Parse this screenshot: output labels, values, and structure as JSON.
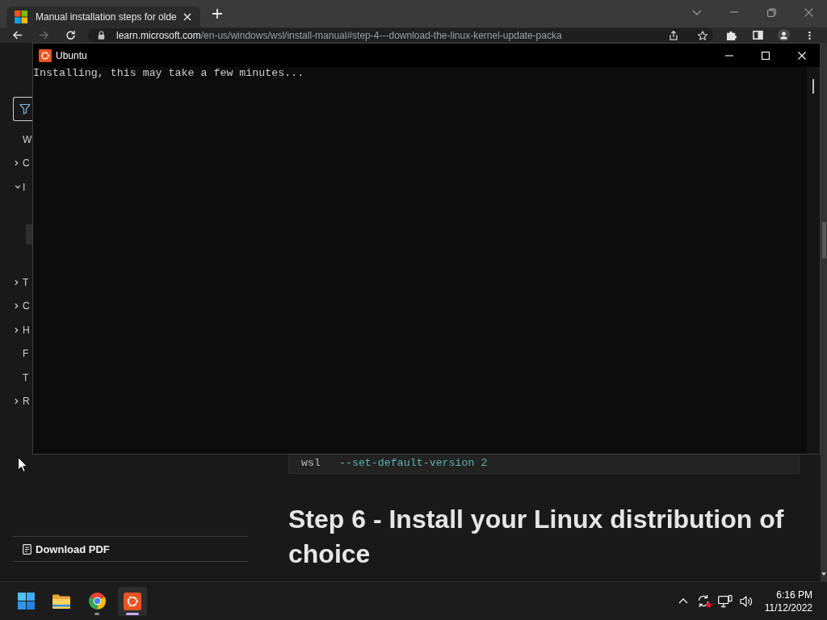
{
  "browser": {
    "tabs": [
      {
        "title": "Manual installation steps for olde",
        "selected": true
      }
    ],
    "toolbar": [
      {
        "kind": "back",
        "disabled": false
      },
      {
        "kind": "forward",
        "disabled": true
      },
      {
        "kind": "reload",
        "disabled": false
      }
    ],
    "address": {
      "host": "learn.microsoft.com",
      "path": "/en-us/windows/wsl/install-manual#step-4---download-the-linux-kernel-update-packa"
    }
  },
  "page": {
    "sidebar": {
      "items": [
        {
          "label": "W"
        },
        {
          "label": "C",
          "expanded": false
        },
        {
          "label": "I",
          "expanded": true,
          "children": [
            {
              "selected": false
            },
            {
              "selected": true
            },
            {
              "selected": false
            }
          ]
        },
        {
          "label": "T",
          "expanded": false
        },
        {
          "label": "C",
          "expanded": false
        },
        {
          "label": "H",
          "expanded": false
        },
        {
          "label": "F"
        },
        {
          "label": "T"
        },
        {
          "label": "R",
          "expanded": false
        }
      ],
      "download": "Download PDF"
    },
    "code": [
      {
        "kind": "command",
        "text": "wsl"
      },
      {
        "kind": "argument",
        "text": "--set-default-version 2"
      }
    ],
    "heading": "Step 6 - Install your Linux distribution of choice"
  },
  "console": {
    "title": "Ubuntu",
    "lines": [
      "Installing, this may take a few minutes..."
    ]
  },
  "taskbar": {
    "apps": [
      {
        "kind": "start",
        "running": false,
        "selected": false
      },
      {
        "kind": "files",
        "running": false,
        "selected": false
      },
      {
        "kind": "chrome",
        "running": true,
        "selected": false
      },
      {
        "kind": "ubuntu",
        "running": true,
        "selected": true
      }
    ],
    "time": "6:16 PM",
    "date": "11/12/2022"
  }
}
